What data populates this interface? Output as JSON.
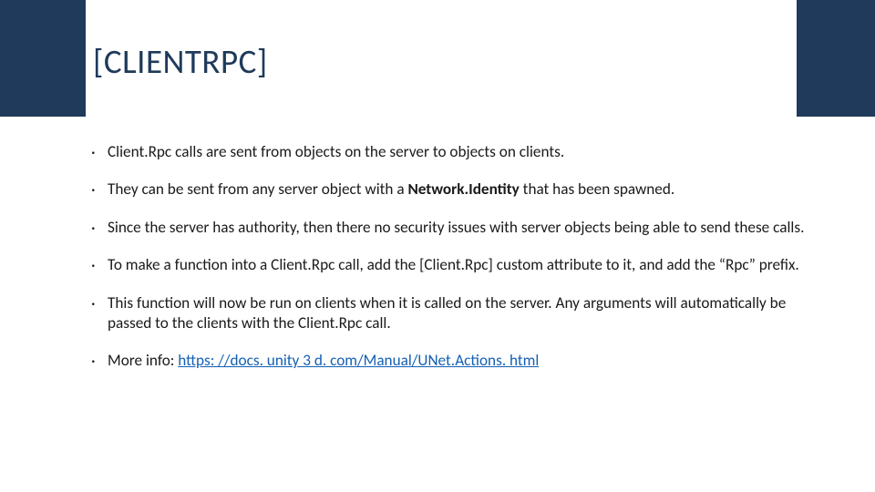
{
  "slide": {
    "title": "[CLIENTRPC]",
    "bullets": [
      {
        "pre": "Client.Rpc calls are sent from objects on the server to objects on clients.",
        "bold": "",
        "post": ""
      },
      {
        "pre": "They can be sent from any server object with a ",
        "bold": "Network.Identity",
        "post": " that has been spawned."
      },
      {
        "pre": "Since the server has authority, then there no security issues with server objects being able to send these calls.",
        "bold": "",
        "post": ""
      },
      {
        "pre": "To make a function into a Client.Rpc call, add the [Client.Rpc] custom attribute to it, and add the “Rpc” prefix.",
        "bold": "",
        "post": ""
      },
      {
        "pre": "This function will now be run on clients when it is called on the server. Any arguments will automatically be passed to the clients with the Client.Rpc call.",
        "bold": "",
        "post": ""
      },
      {
        "pre": "More info: ",
        "bold": "",
        "post": "",
        "link": "https: //docs. unity 3 d. com/Manual/UNet.Actions. html"
      }
    ]
  },
  "colors": {
    "band": "#1f3a5a",
    "link": "#1560b4"
  }
}
